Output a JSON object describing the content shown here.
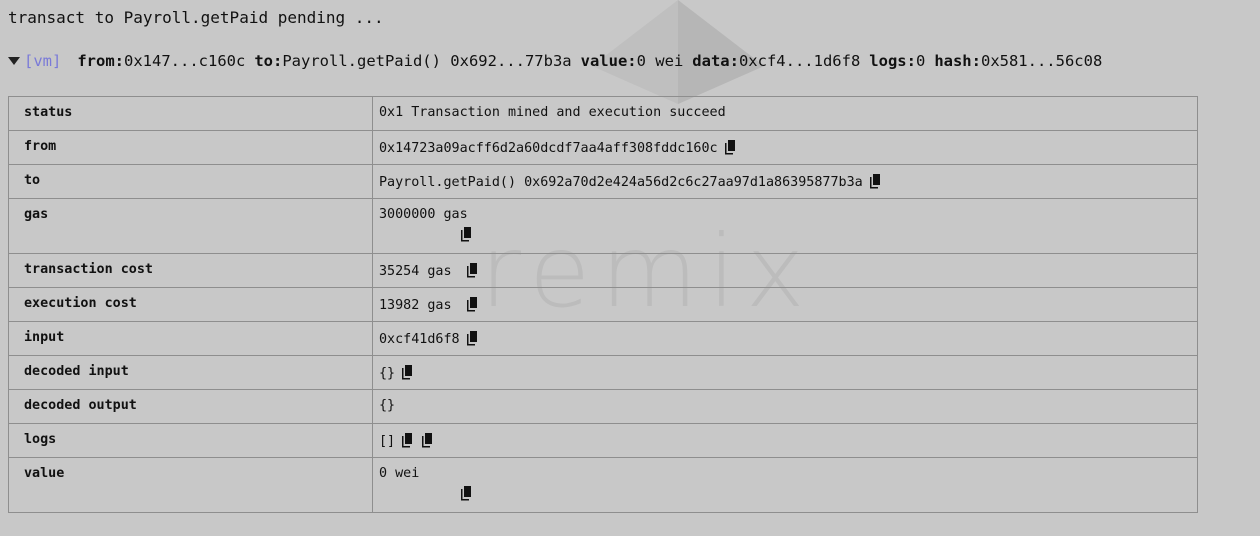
{
  "watermark": {
    "text": "remix"
  },
  "pending": "transact to Payroll.getPaid pending ...",
  "summary": {
    "vm": "[vm]",
    "from_key": "from:",
    "from_val": "0x147...c160c",
    "to_key": "to:",
    "to_val": "Payroll.getPaid() 0x692...77b3a",
    "value_key": "value:",
    "value_val": "0 wei",
    "data_key": "data:",
    "data_val": "0xcf4...1d6f8",
    "logs_key": "logs:",
    "logs_val": "0",
    "hash_key": "hash:",
    "hash_val": "0x581...56c08"
  },
  "rows": [
    {
      "key": "status",
      "value": "0x1 Transaction mined and execution succeed"
    },
    {
      "key": "from",
      "value": "0x14723a09acff6d2a60dcdf7aa4aff308fddc160c"
    },
    {
      "key": "to",
      "value": "Payroll.getPaid() 0x692a70d2e424a56d2c6c27aa97d1a86395877b3a"
    },
    {
      "key": "gas",
      "value": "3000000 gas"
    },
    {
      "key": "transaction cost",
      "value": "35254 gas"
    },
    {
      "key": "execution cost",
      "value": "13982 gas"
    },
    {
      "key": "input",
      "value": "0xcf41d6f8"
    },
    {
      "key": "decoded input",
      "value": "{}"
    },
    {
      "key": "decoded output",
      "value": "{}"
    },
    {
      "key": "logs",
      "value": "[]"
    },
    {
      "key": "value",
      "value": "0 wei"
    }
  ]
}
